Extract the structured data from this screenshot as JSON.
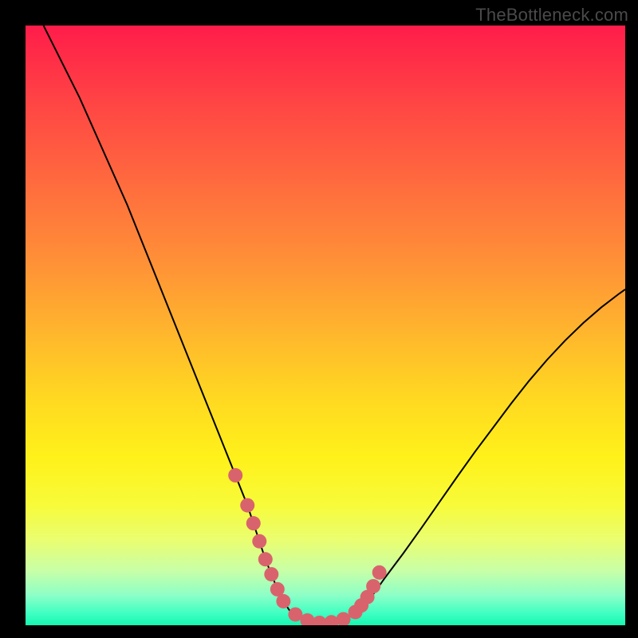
{
  "watermark": "TheBottleneck.com",
  "colors": {
    "curve_stroke": "#000000",
    "marker_fill": "#d9636c",
    "gradient_stops": [
      "#ff1c4a",
      "#ff2f47",
      "#ff4844",
      "#ff6a3e",
      "#ff8c38",
      "#ffb22e",
      "#ffd821",
      "#fff11a",
      "#f7fb3a",
      "#e9fe72",
      "#c7ffa8",
      "#8cffc7",
      "#40ffc2",
      "#14f7b1"
    ]
  },
  "chart_data": {
    "type": "line",
    "title": "",
    "xlabel": "",
    "ylabel": "",
    "xlim": [
      0,
      100
    ],
    "ylim": [
      0,
      100
    ],
    "x": [
      3,
      5,
      7,
      9,
      11,
      13,
      15,
      17,
      19,
      21,
      23,
      25,
      27,
      29,
      31,
      33,
      35,
      37,
      38,
      39,
      40,
      41,
      42,
      43,
      44,
      46,
      48,
      50,
      52,
      54,
      56,
      58,
      60,
      63,
      66,
      69,
      72,
      75,
      78,
      81,
      84,
      87,
      90,
      93,
      96,
      99,
      100
    ],
    "values": [
      100,
      96,
      92,
      88,
      83.5,
      79,
      74.5,
      70,
      65,
      60,
      55,
      50,
      45,
      40,
      35,
      30,
      25,
      20,
      17,
      14,
      11,
      8.5,
      6,
      4,
      2.5,
      1.2,
      0.6,
      0.4,
      0.6,
      1.4,
      3,
      5.2,
      8,
      12,
      16.2,
      20.5,
      24.8,
      29,
      33,
      37,
      40.8,
      44.3,
      47.5,
      50.4,
      53,
      55.3,
      56
    ],
    "markers": {
      "x": [
        35,
        37,
        38,
        39,
        40,
        41,
        42,
        43,
        45,
        47,
        49,
        51,
        53,
        55,
        56,
        57,
        58,
        59
      ],
      "values": [
        25,
        20,
        17,
        14,
        11,
        8.5,
        6,
        4,
        1.8,
        0.8,
        0.4,
        0.5,
        1,
        2.2,
        3.3,
        4.7,
        6.5,
        8.8
      ]
    }
  }
}
